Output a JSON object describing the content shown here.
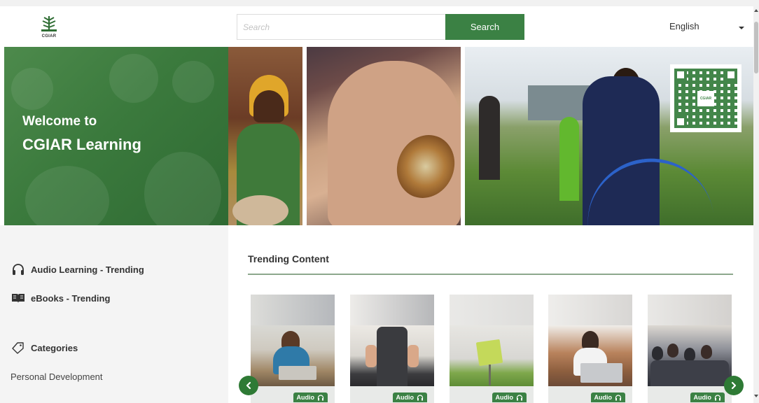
{
  "header": {
    "logo_text": "CGIAR",
    "search_placeholder": "Search",
    "search_button": "Search",
    "language": "English"
  },
  "hero": {
    "title_line1": "Welcome to",
    "title_line2": "CGIAR Learning",
    "qr_logo_text": "CGIAR"
  },
  "sidebar": {
    "audio_label": "Audio Learning - Trending",
    "ebooks_label": "eBooks - Trending",
    "categories_label": "Categories",
    "category_items": [
      "Personal Development"
    ]
  },
  "trending": {
    "title": "Trending Content",
    "cards": [
      {
        "badge": "Audio"
      },
      {
        "badge": "Audio"
      },
      {
        "badge": "Audio"
      },
      {
        "badge": "Audio"
      },
      {
        "badge": "Audio"
      }
    ]
  },
  "icons": {
    "audio": "headphones-icon",
    "ebooks": "book-icon",
    "categories": "tag-icon",
    "prev": "chevron-left-icon",
    "next": "chevron-right-icon",
    "dropdown": "caret-down-icon"
  },
  "colors": {
    "brand_green": "#3b8144",
    "dark_green": "#2e7a35",
    "sidebar_bg": "#f4f4f4"
  }
}
